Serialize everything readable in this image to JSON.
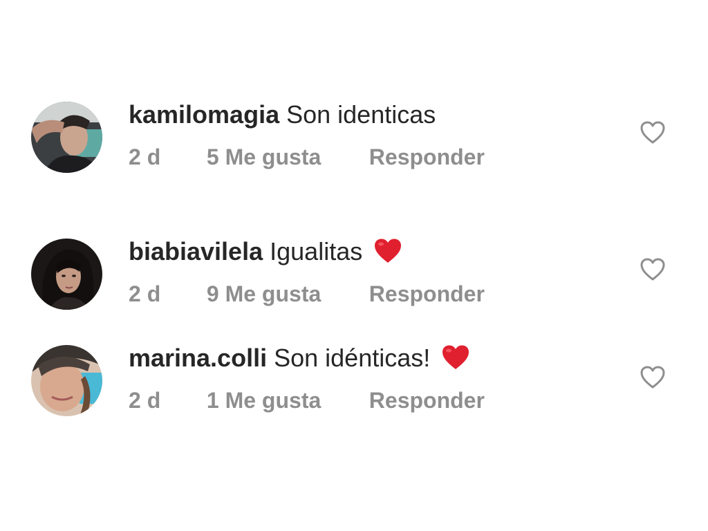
{
  "comments": [
    {
      "username": "kamilomagia",
      "text": "Son identicas",
      "emoji": "",
      "time": "2 d",
      "likes": "5 Me gusta",
      "reply": "Responder",
      "avatar_icon": "avatar-photo-man"
    },
    {
      "username": "biabiavilela",
      "text": "Igualitas",
      "emoji": "red-heart",
      "time": "2 d",
      "likes": "9 Me gusta",
      "reply": "Responder",
      "avatar_icon": "avatar-photo-woman"
    },
    {
      "username": "marina.colli",
      "text": "Son idénticas!",
      "emoji": "red-heart",
      "time": "2 d",
      "likes": "1 Me gusta",
      "reply": "Responder",
      "avatar_icon": "avatar-photo-woman"
    }
  ],
  "icons": {
    "like": "heart-outline-icon",
    "emoji": "red-heart-emoji"
  },
  "colors": {
    "username": "#262626",
    "meta": "#8e8e8e",
    "heart_emoji": "#e0202f",
    "like_icon": "#8e8e8e"
  }
}
